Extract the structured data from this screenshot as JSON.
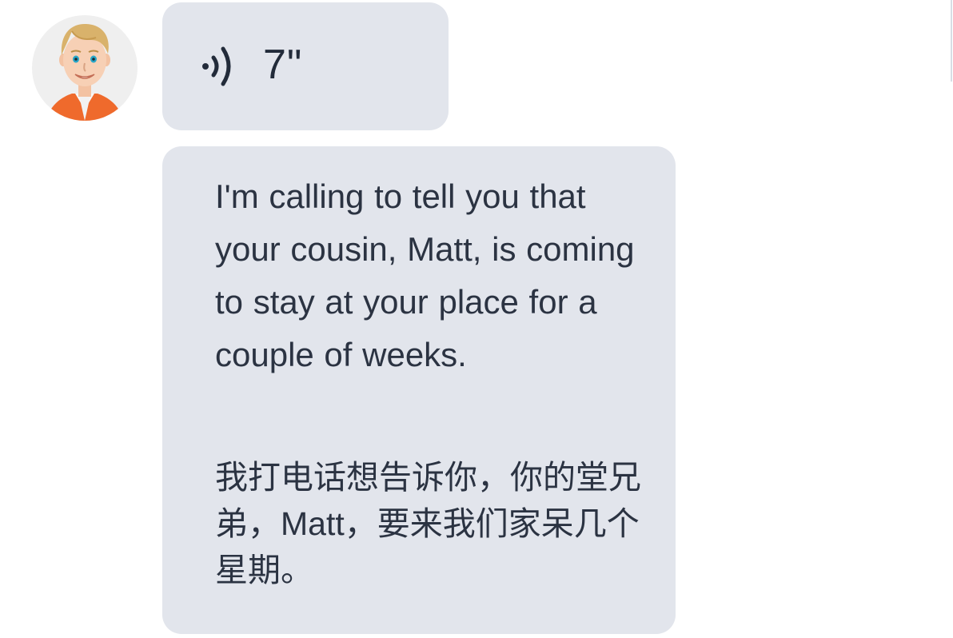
{
  "message": {
    "sender": {
      "avatar_icon": "cartoon-man-avatar-icon"
    },
    "audio": {
      "icon": "speaker-wave-icon",
      "duration": "7\""
    },
    "text": {
      "english": "I'm calling to tell you that your cousin, Matt, is coming to stay at your place for a couple of weeks.",
      "chinese": "我打电话想告诉你，你的堂兄弟，Matt，要来我们家呆几个星期。"
    }
  },
  "colors": {
    "bubble_background": "#e2e5ec",
    "text": "#2b3342",
    "avatar_background": "#efefef",
    "avatar_shirt": "#ef6a2c",
    "avatar_hair": "#d9b26b"
  }
}
